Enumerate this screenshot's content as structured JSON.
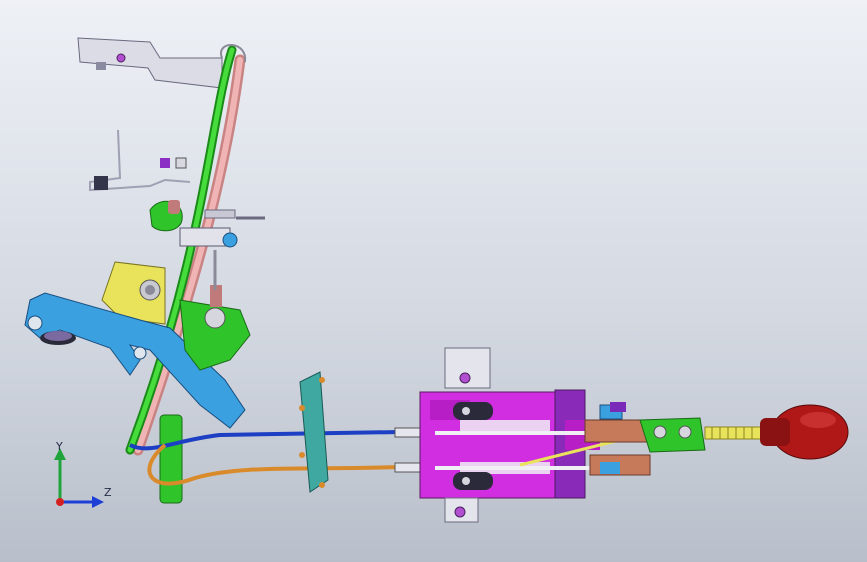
{
  "viewport": {
    "background_top": "#eef1f6",
    "background_bottom": "#b9bfca"
  },
  "triad": {
    "y_label": "Y",
    "z_label": "Z",
    "y_color": "#1fa33a",
    "z_color": "#1d3fd6",
    "x_color": "#d42020"
  },
  "colors": {
    "cable_blue": "#1c3fc4",
    "cable_orange": "#d98b2c",
    "rod_green": "#2ec42a",
    "rod_pink": "#e9a3a3",
    "bracket_blue": "#3aa0e0",
    "housing_magenta": "#d02ee0",
    "knob_red": "#b01818",
    "yellow_block": "#e8e35a",
    "metal": "#d6d6de",
    "teal_plate": "#3fa8a0"
  }
}
